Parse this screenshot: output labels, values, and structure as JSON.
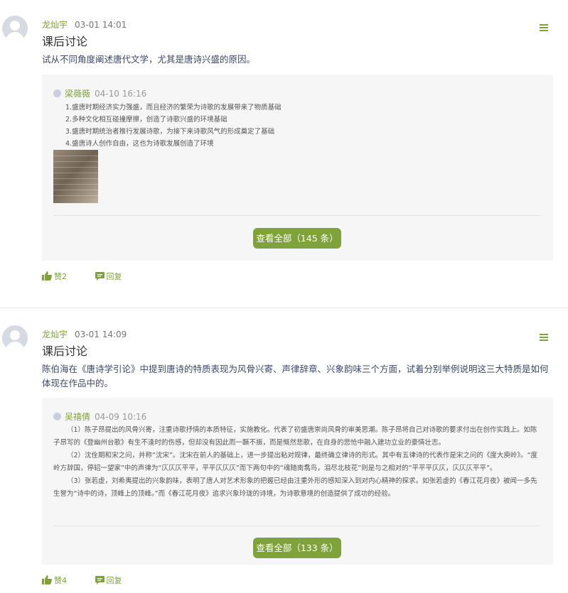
{
  "colors": {
    "accent": "#7fa33a",
    "panel": "#f6f6f6",
    "question_text": "#3c4a6b"
  },
  "posts": [
    {
      "author": "龙灿宇",
      "time": "03-01 14:01",
      "title": "课后讨论",
      "question": "试从不同角度阐述唐代文学，尤其是唐诗兴盛的原因。",
      "reply": {
        "author": "梁薇薇",
        "time": "04-10 16:16",
        "lines": [
          "1.盛唐时期经济实力强盛，而且经济的繁荣为诗歌的发展带来了物质基础",
          "2.多种文化相互碰撞摩擦，创造了诗歌兴盛的环境基础",
          "3.盛唐时期统治者推行发展诗歌，为接下来诗歌风气的形成奠定了基础",
          "4.盛唐诗人创作自由，这也为诗歌发展创造了环境"
        ]
      },
      "view_all": "查看全部（145 条）",
      "like_label": "赞2",
      "reply_label": "回复"
    },
    {
      "author": "龙灿宇",
      "time": "03-01 14:09",
      "title": "课后讨论",
      "question": "陈伯海在《唐诗学引论》中提到唐诗的特质表现为风骨兴寄、声律辞章、兴象韵味三个方面，试着分别举例说明这三大特质是如何体现在作品中的。",
      "reply": {
        "author": "吴禧倩",
        "time": "04-09 10:16",
        "paragraphs": [
          "（1）陈子昂提出的风骨兴寄，注重诗歌抒情的本质特征，实施教化。代表了初盛唐崇尚风骨的审美思潮。陈子昂将自己对诗歌的要求付出在创作实践上。如陈子昂写的《登幽州台歌》有生不逢时的伤感，但却没有因此而一蹶不振，而是慨然悲歌，在自身的悲怆中融入建功立业的豪情壮志。",
          "（2）沈佺期和宋之问，并称“沈宋”。沈宋在前人的基础上，进一步提出粘对规律，最终确立律诗的形式。其中有五律诗的代表作是宋之问的《度大庾岭》。“度岭方辞国，停轺一望家”中的声律为“仄仄仄平平，平平仄仄仄”而下两句中的“魂随南翥鸟，泪尽北枝花”则是与之相对的“平平平仄仄，仄仄仄平平”。",
          "（3）张若虚，刘希夷提出的兴象韵味，表明了唐人对艺术形象的把握已经由注重外形的感知深入到对内心精神的探求。如张若虚的《春江花月夜》被闻一多先生誉为“诗中的诗，顶峰上的顶峰。”而《春江花月夜》追求兴象玲珑的诗境，为诗歌意境的创造提供了成功的经验。"
        ]
      },
      "view_all": "查看全部（133 条）",
      "like_label": "赞4",
      "reply_label": "回复"
    }
  ]
}
